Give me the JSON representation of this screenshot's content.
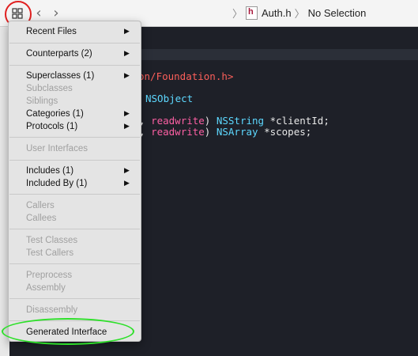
{
  "jumpbar": {
    "file_icon_letter": "h",
    "file_name": "Auth.h",
    "selection": "No Selection",
    "separator": "〉"
  },
  "icons": {
    "related_items": "related-items-grid-icon",
    "back": "chevron-left-icon",
    "forward": "chevron-right-icon",
    "submenu": "triangle-right-icon"
  },
  "code": {
    "line1": "on/Foundation.h>",
    "line2": "NSObject",
    "line3_punct": ", ",
    "line3_kw": "readwrite",
    "line3_mid": ") ",
    "line3_type": "NSString",
    "line3_rest": " *clientId;",
    "line4_punct": ", ",
    "line4_kw": "readwrite",
    "line4_mid": ") ",
    "line4_type": "NSArray",
    "line4_rest": " *scopes;"
  },
  "menu": {
    "items": [
      {
        "label": "Recent Files",
        "enabled": true,
        "submenu": true
      },
      {
        "label": "Counterparts (2)",
        "enabled": true,
        "submenu": true
      },
      {
        "label": "Superclasses (1)",
        "enabled": true,
        "submenu": true
      },
      {
        "label": "Subclasses",
        "enabled": false,
        "submenu": false
      },
      {
        "label": "Siblings",
        "enabled": false,
        "submenu": false
      },
      {
        "label": "Categories (1)",
        "enabled": true,
        "submenu": true
      },
      {
        "label": "Protocols (1)",
        "enabled": true,
        "submenu": true
      },
      {
        "label": "User Interfaces",
        "enabled": false,
        "submenu": false
      },
      {
        "label": "Includes (1)",
        "enabled": true,
        "submenu": true
      },
      {
        "label": "Included By (1)",
        "enabled": true,
        "submenu": true
      },
      {
        "label": "Callers",
        "enabled": false,
        "submenu": false
      },
      {
        "label": "Callees",
        "enabled": false,
        "submenu": false
      },
      {
        "label": "Test Classes",
        "enabled": false,
        "submenu": false
      },
      {
        "label": "Test Callers",
        "enabled": false,
        "submenu": false
      },
      {
        "label": "Preprocess",
        "enabled": false,
        "submenu": false
      },
      {
        "label": "Assembly",
        "enabled": false,
        "submenu": false
      },
      {
        "label": "Disassembly",
        "enabled": false,
        "submenu": false
      },
      {
        "label": "Generated Interface",
        "enabled": true,
        "submenu": false
      }
    ]
  },
  "annotations": {
    "red_circle_color": "#e02020",
    "green_ellipse_color": "#2ee02a"
  }
}
